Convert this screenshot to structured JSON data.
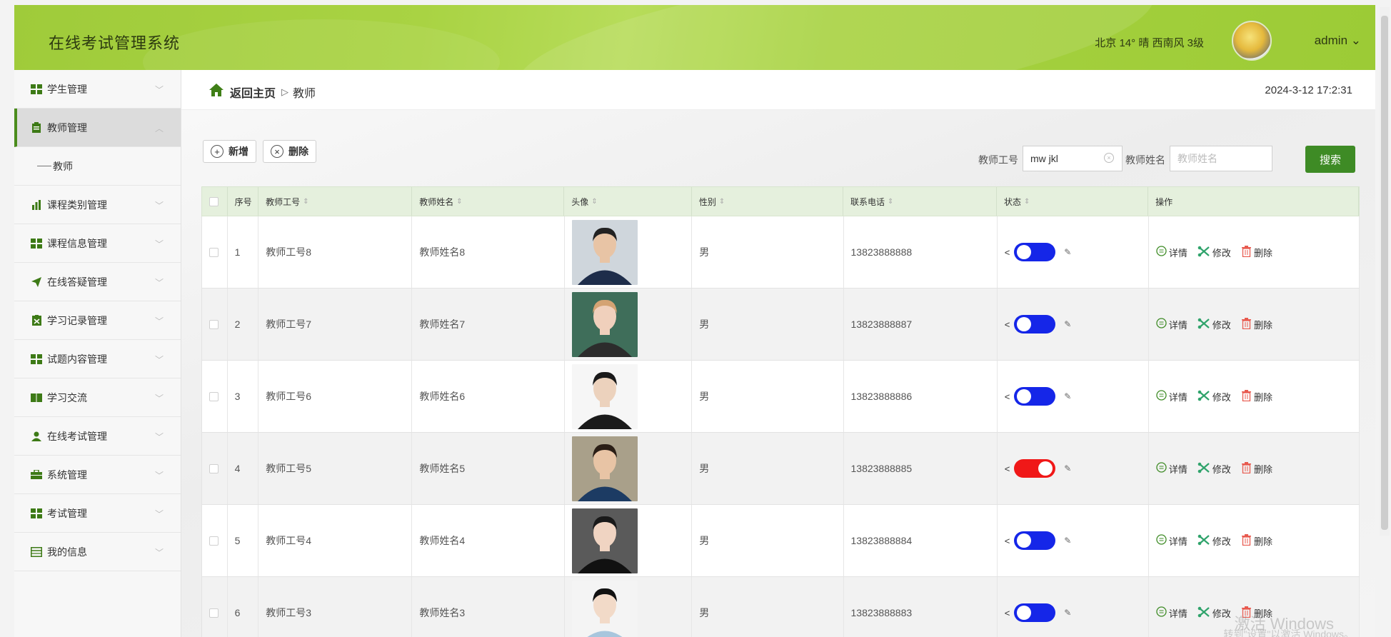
{
  "header": {
    "app_title": "在线考试管理系统",
    "weather": "北京 14° 晴 西南风 3级",
    "user": "admin ⌄"
  },
  "sidebar": {
    "items": [
      {
        "label": "学生管理",
        "icon": "grid-icon"
      },
      {
        "label": "教师管理",
        "icon": "clipboard-icon",
        "active": true
      },
      {
        "label": "课程类别管理",
        "icon": "bar-chart-icon"
      },
      {
        "label": "课程信息管理",
        "icon": "grid-icon"
      },
      {
        "label": "在线答疑管理",
        "icon": "send-icon"
      },
      {
        "label": "学习记录管理",
        "icon": "document-icon"
      },
      {
        "label": "试题内容管理",
        "icon": "grid-icon"
      },
      {
        "label": "学习交流",
        "icon": "book-icon"
      },
      {
        "label": "在线考试管理",
        "icon": "user-icon"
      },
      {
        "label": "系统管理",
        "icon": "briefcase-icon"
      },
      {
        "label": "考试管理",
        "icon": "grid-icon"
      },
      {
        "label": "我的信息",
        "icon": "window-icon"
      }
    ],
    "submenu": {
      "label": "教师"
    }
  },
  "breadcrumb": {
    "back": "返回主页",
    "sep": "▷",
    "current": "教师"
  },
  "datetime": "2024-3-12 17:2:31",
  "toolbar": {
    "add_label": "新增",
    "delete_label": "删除"
  },
  "search": {
    "id_label": "教师工号",
    "id_value": "mw jkl",
    "name_label": "教师姓名",
    "name_placeholder": "教师姓名",
    "search_label": "搜索"
  },
  "table": {
    "headers": [
      "序号",
      "教师工号",
      "教师姓名",
      "头像",
      "性别",
      "联系电话",
      "状态",
      "操作"
    ],
    "rows": [
      {
        "no": "1",
        "id": "教师工号8",
        "name": "教师姓名8",
        "gender": "男",
        "phone": "13823888888",
        "status": "on"
      },
      {
        "no": "2",
        "id": "教师工号7",
        "name": "教师姓名7",
        "gender": "男",
        "phone": "13823888887",
        "status": "on"
      },
      {
        "no": "3",
        "id": "教师工号6",
        "name": "教师姓名6",
        "gender": "男",
        "phone": "13823888886",
        "status": "on"
      },
      {
        "no": "4",
        "id": "教师工号5",
        "name": "教师姓名5",
        "gender": "男",
        "phone": "13823888885",
        "status": "off"
      },
      {
        "no": "5",
        "id": "教师工号4",
        "name": "教师姓名4",
        "gender": "男",
        "phone": "13823888884",
        "status": "on"
      },
      {
        "no": "6",
        "id": "教师工号3",
        "name": "教师姓名3",
        "gender": "男",
        "phone": "13823888883",
        "status": "on"
      }
    ],
    "ops": {
      "detail": "详情",
      "edit": "修改",
      "delete": "删除"
    },
    "toggle_prefix": "<",
    "pen": "✎"
  },
  "watermark": {
    "line1": "激活 Windows",
    "line2": "转到\"设置\"以激活 Windows。"
  },
  "colors": {
    "toggle_on": "#1526e8",
    "toggle_off": "#f01818",
    "accent": "#3e8b25"
  }
}
